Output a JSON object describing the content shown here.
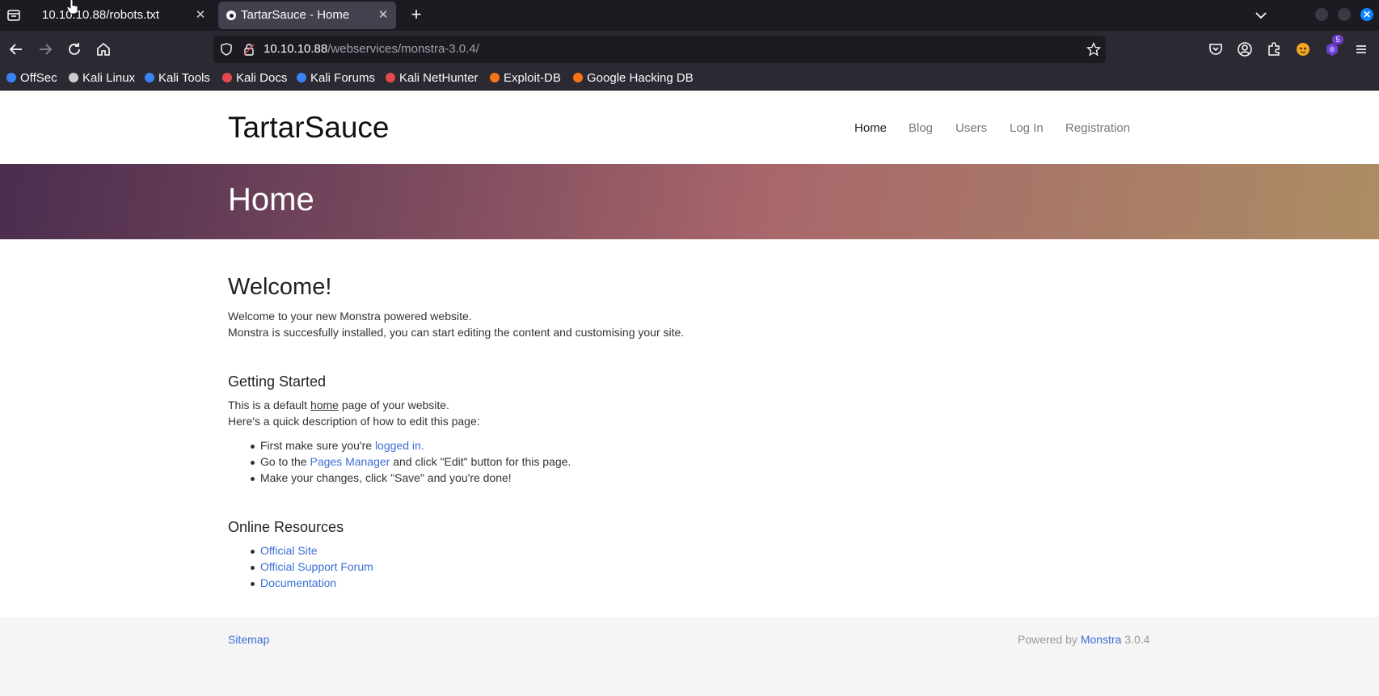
{
  "browser": {
    "tabs": [
      {
        "title": "10.10.10.88/robots.txt"
      },
      {
        "title": "TartarSauce - Home"
      }
    ],
    "url": {
      "host": "10.10.10.88",
      "path": "/webservices/monstra-3.0.4/"
    },
    "extensions_badge": "5",
    "bookmarks": [
      {
        "label": "OffSec",
        "color": "#3b82f6"
      },
      {
        "label": "Kali Linux",
        "color": "#cccccc"
      },
      {
        "label": "Kali Tools",
        "color": "#3b82f6"
      },
      {
        "label": "Kali Docs",
        "color": "#e5484d"
      },
      {
        "label": "Kali Forums",
        "color": "#3b82f6"
      },
      {
        "label": "Kali NetHunter",
        "color": "#e5484d"
      },
      {
        "label": "Exploit-DB",
        "color": "#f97316"
      },
      {
        "label": "Google Hacking DB",
        "color": "#f97316"
      }
    ]
  },
  "site": {
    "title": "TartarSauce",
    "nav": [
      "Home",
      "Blog",
      "Users",
      "Log In",
      "Registration"
    ],
    "hero_title": "Home",
    "welcome": {
      "heading": "Welcome!",
      "line1": "Welcome to your new Monstra powered website.",
      "line2": "Monstra is succesfully installed, you can start editing the content and customising your site."
    },
    "getting_started": {
      "heading": "Getting Started",
      "line1_pre": "This is a default ",
      "line1_link": "home",
      "line1_post": " page of your website.",
      "line2": "Here's a quick description of how to edit this page:",
      "item1_pre": "First make sure you're ",
      "item1_link": "logged in.",
      "item2_pre": "Go to the ",
      "item2_link": "Pages Manager",
      "item2_post": " and click \"Edit\" button for this page.",
      "item3": "Make your changes, click \"Save\" and you're done!"
    },
    "online_resources": {
      "heading": "Online Resources",
      "links": [
        "Official Site",
        "Official Support Forum",
        "Documentation"
      ]
    },
    "footer": {
      "sitemap": "Sitemap",
      "powered_pre": "Powered by ",
      "powered_link": "Monstra",
      "version": " 3.0.4"
    }
  }
}
